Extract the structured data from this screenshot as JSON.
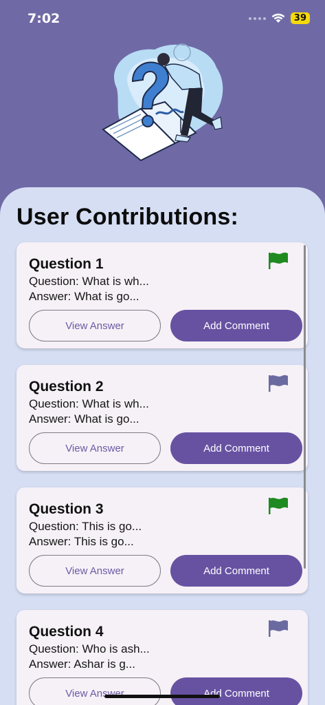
{
  "status": {
    "time": "7:02",
    "battery": "39"
  },
  "page": {
    "title": "User Contributions:"
  },
  "colors": {
    "flag_active": "#1f8a1f",
    "flag_inactive": "#6b6aa0",
    "primary": "#6752a2"
  },
  "cards": [
    {
      "title": "Question 1",
      "question": "Question: What is wh...",
      "answer": "Answer: What is go...",
      "flag": "green-flag-icon",
      "view_label": "View Answer",
      "comment_label": "Add Comment"
    },
    {
      "title": "Question 2",
      "question": "Question: What is wh...",
      "answer": "Answer: What is go...",
      "flag": "gray-flag-icon",
      "view_label": "View Answer",
      "comment_label": "Add Comment"
    },
    {
      "title": "Question 3",
      "question": "Question: This is go...",
      "answer": "Answer: This is go...",
      "flag": "green-flag-icon",
      "view_label": "View Answer",
      "comment_label": "Add Comment"
    },
    {
      "title": "Question 4",
      "question": "Question: Who is ash...",
      "answer": "Answer: Ashar is g...",
      "flag": "gray-flag-icon",
      "view_label": "View Answer",
      "comment_label": "Add Comment"
    }
  ]
}
